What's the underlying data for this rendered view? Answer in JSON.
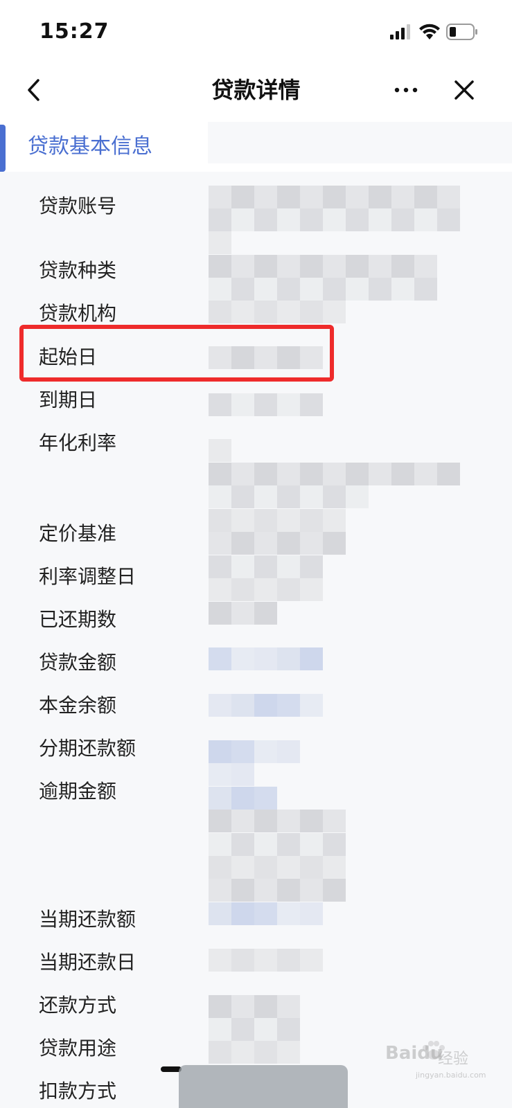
{
  "status_bar": {
    "time": "15:27",
    "icons": [
      "cellular-signal-icon",
      "wifi-icon",
      "battery-icon"
    ]
  },
  "nav": {
    "title": "贷款详情",
    "back_icon": "chevron-left-icon",
    "more_icon": "more-horizontal-icon",
    "close_icon": "close-icon"
  },
  "section": {
    "title": "贷款基本信息"
  },
  "fields": [
    {
      "label": "贷款账号"
    },
    {
      "label": "贷款种类"
    },
    {
      "label": "贷款机构"
    },
    {
      "label": "起始日"
    },
    {
      "label": "到期日"
    },
    {
      "label": "年化利率"
    },
    {
      "label": "定价基准"
    },
    {
      "label": "利率调整日"
    },
    {
      "label": "已还期数"
    },
    {
      "label": "贷款金额"
    },
    {
      "label": "本金余额"
    },
    {
      "label": "分期还款额"
    },
    {
      "label": "逾期金额"
    },
    {
      "label": "当期还款额"
    },
    {
      "label": "当期还款日"
    },
    {
      "label": "还款方式"
    },
    {
      "label": "贷款用途"
    },
    {
      "label": "扣款方式"
    }
  ],
  "colors": {
    "accent": "#4a6fd1",
    "highlight": "#ee2b2b",
    "background": "#f7f8fa"
  },
  "watermark": {
    "brand": "Bai",
    "brand_suffix": "du",
    "sub": "经验",
    "url": "jingyan.baidu.com"
  }
}
